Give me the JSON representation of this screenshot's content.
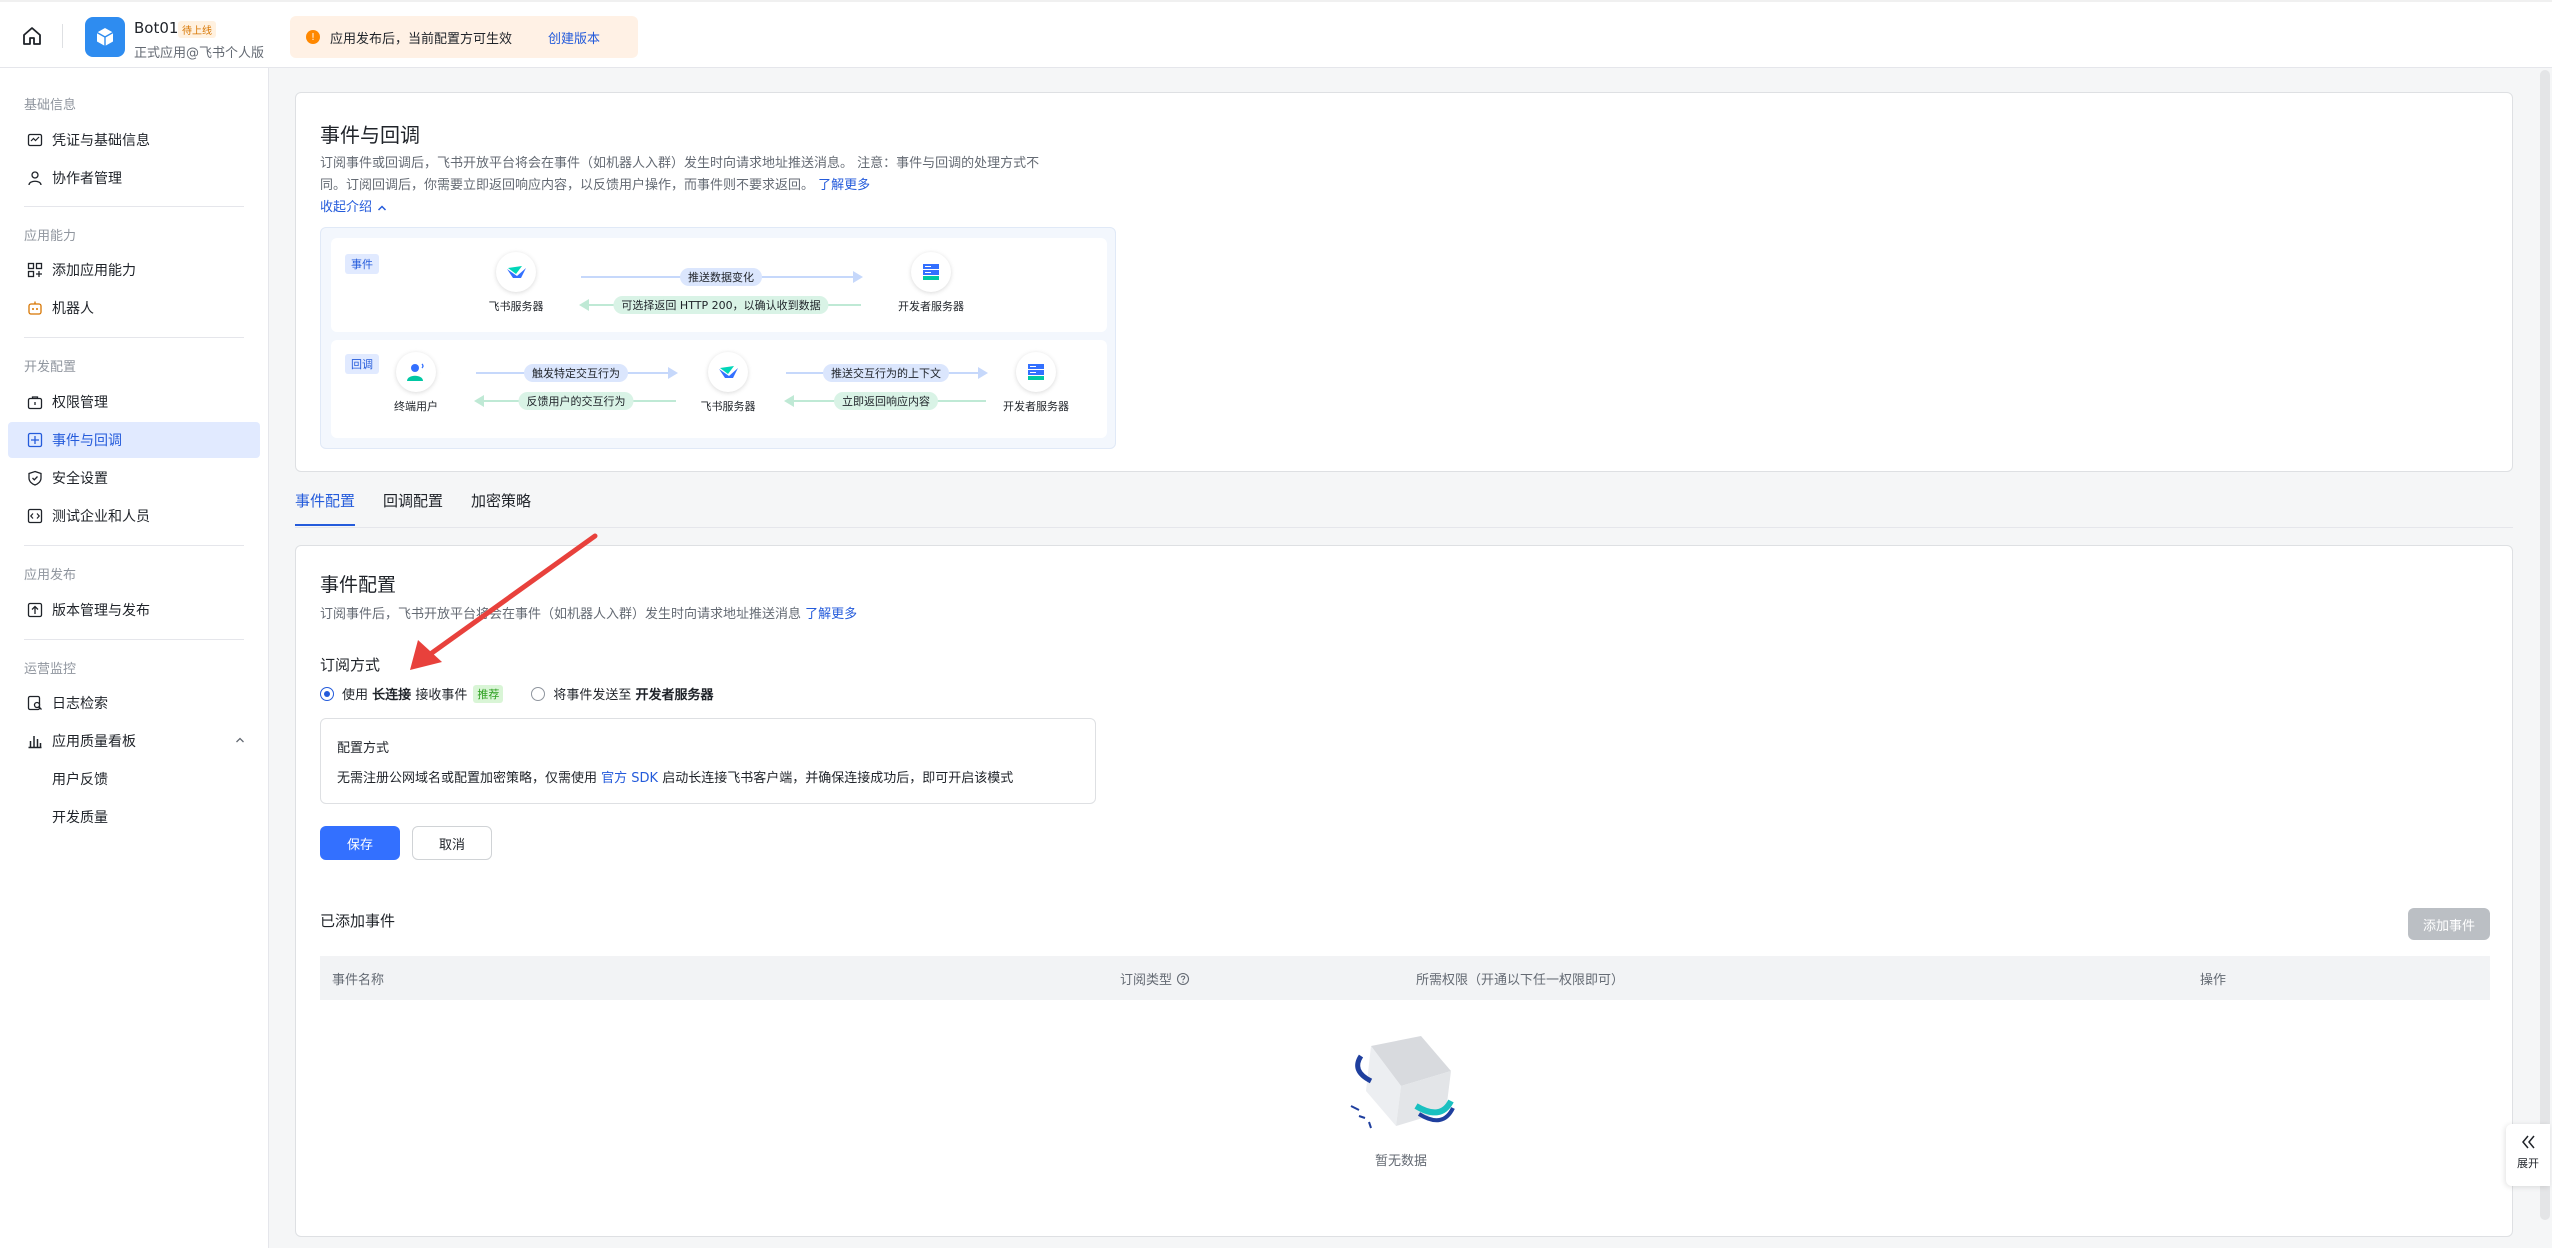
{
  "header": {
    "app_name": "Bot01",
    "app_status": "待上线",
    "app_subtitle": "正式应用@飞书个人版",
    "notice_text": "应用发布后，当前配置方可生效",
    "notice_link": "创建版本"
  },
  "sidebar": {
    "sections": [
      {
        "title": "基础信息",
        "items": [
          "凭证与基础信息",
          "协作者管理"
        ]
      },
      {
        "title": "应用能力",
        "items": [
          "添加应用能力",
          "机器人"
        ]
      },
      {
        "title": "开发配置",
        "items": [
          "权限管理",
          "事件与回调",
          "安全设置",
          "测试企业和人员"
        ]
      },
      {
        "title": "应用发布",
        "items": [
          "版本管理与发布"
        ]
      },
      {
        "title": "运营监控",
        "items": [
          "日志检索",
          "应用质量看板",
          "用户反馈",
          "开发质量"
        ]
      }
    ],
    "active_item": "事件与回调"
  },
  "intro": {
    "title": "事件与回调",
    "desc_line1": "订阅事件或回调后，飞书开放平台将会在事件（如机器人入群）发生时向请求地址推送消息。 注意：事件与回调的处理方式不",
    "desc_line2": "同。订阅回调后，你需要立即返回响应内容，以反馈用户操作，而事件则不要求返回。",
    "learn_more": "了解更多",
    "collapse": "收起介绍",
    "event_tag": "事件",
    "callback_tag": "回调",
    "nodes": {
      "feishu_server": "飞书服务器",
      "dev_server": "开发者服务器",
      "end_user": "终端用户"
    },
    "event_arrows": {
      "push": "推送数据变化",
      "ack": "可选择返回 HTTP 200，以确认收到数据"
    },
    "callback_arrows": {
      "trigger": "触发特定交互行为",
      "feedback": "反馈用户的交互行为",
      "push_ctx": "推送交互行为的上下文",
      "respond": "立即返回响应内容"
    }
  },
  "tabs": [
    "事件配置",
    "回调配置",
    "加密策略"
  ],
  "config": {
    "title": "事件配置",
    "desc": "订阅事件后，飞书开放平台将会在事件（如机器人入群）发生时向请求地址推送消息",
    "learn_more": "了解更多",
    "subscribe_label": "订阅方式",
    "option1_pre": "使用",
    "option1_bold": "长连接",
    "option1_post": "接收事件",
    "option1_tag": "推荐",
    "option2_pre": "将事件发送至",
    "option2_bold": "开发者服务器",
    "box_title": "配置方式",
    "box_pre": "无需注册公网域名或配置加密策略，仅需使用",
    "box_link": "官方 SDK",
    "box_post": "启动长连接飞书客户端，并确保连接成功后，即可开启该模式",
    "save": "保存",
    "cancel": "取消",
    "added_title": "已添加事件",
    "add_btn": "添加事件",
    "columns": [
      "事件名称",
      "订阅类型",
      "所需权限（开通以下任一权限即可）",
      "操作"
    ],
    "empty": "暂无数据"
  },
  "expand_label": "展开"
}
